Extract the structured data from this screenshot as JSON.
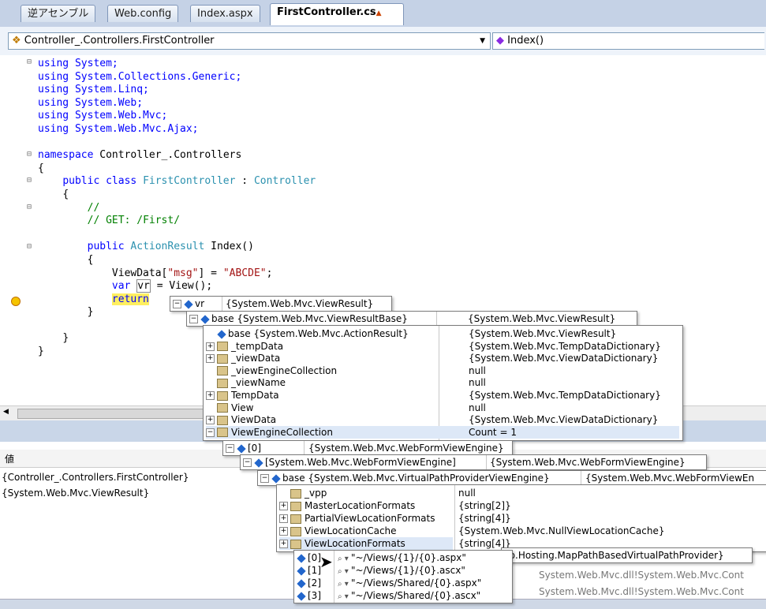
{
  "tabs": [
    {
      "label": "逆アセンブル"
    },
    {
      "label": "Web.config"
    },
    {
      "label": "Index.aspx"
    },
    {
      "label": "FirstController.cs"
    }
  ],
  "nav": {
    "class_combo": "Controller_.Controllers.FirstController",
    "member_combo": "Index()"
  },
  "code": {
    "l1": "using System;",
    "l2": "using System.Collections.Generic;",
    "l3": "using System.Linq;",
    "l4": "using System.Web;",
    "l5": "using System.Web.Mvc;",
    "l6": "using System.Web.Mvc.Ajax;",
    "ns_kw": "namespace",
    "ns_name": " Controller_.Controllers",
    "brace": "{",
    "brace_close": "}",
    "cls_kw": "public class ",
    "cls_name": "FirstController",
    "cls_sep": " : ",
    "cls_base": "Controller",
    "cmt1": "//",
    "cmt2": "// GET: /First/",
    "m_kw": "public ",
    "m_type": "ActionResult",
    "m_rest": " Index()",
    "vd_a": "ViewData[",
    "vd_key": "\"msg\"",
    "vd_b": "] = ",
    "vd_val": "\"ABCDE\"",
    "vd_c": ";",
    "var_kw": "var ",
    "var_name": "vr",
    "var_rest": " = View();",
    "ret": "return"
  },
  "tip1": {
    "name": "vr",
    "value": "{System.Web.Mvc.ViewResult}"
  },
  "tip2": {
    "name": "base {System.Web.Mvc.ViewResultBase}",
    "value": "{System.Web.Mvc.ViewResult}"
  },
  "tip3": [
    {
      "name": "base {System.Web.Mvc.ActionResult}",
      "value": "{System.Web.Mvc.ViewResult}"
    },
    {
      "name": "_tempData",
      "value": "{System.Web.Mvc.TempDataDictionary}"
    },
    {
      "name": "_viewData",
      "value": "{System.Web.Mvc.ViewDataDictionary}"
    },
    {
      "name": "_viewEngineCollection",
      "value": "null"
    },
    {
      "name": "_viewName",
      "value": "null"
    },
    {
      "name": "TempData",
      "value": "{System.Web.Mvc.TempDataDictionary}"
    },
    {
      "name": "View",
      "value": "null"
    },
    {
      "name": "ViewData",
      "value": "{System.Web.Mvc.ViewDataDictionary}"
    },
    {
      "name": "ViewEngineCollection",
      "value": "Count = 1"
    }
  ],
  "tip4": {
    "name": "[0]",
    "value": "{System.Web.Mvc.WebFormViewEngine}"
  },
  "tip5": {
    "name": "[System.Web.Mvc.WebFormViewEngine]",
    "value": "{System.Web.Mvc.WebFormViewEngine}"
  },
  "tip6": {
    "name": "base {System.Web.Mvc.VirtualPathProviderViewEngine}",
    "value": "{System.Web.Mvc.WebFormViewEn"
  },
  "tip7": [
    {
      "name": "_vpp",
      "value": "null"
    },
    {
      "name": "MasterLocationFormats",
      "value": "{string[2]}"
    },
    {
      "name": "PartialViewLocationFormats",
      "value": "{string[4]}"
    },
    {
      "name": "ViewLocationCache",
      "value": "{System.Web.Mvc.NullViewLocationCache}"
    },
    {
      "name": "ViewLocationFormats",
      "value": "{string[4]}"
    }
  ],
  "tip8": {
    "value": "eb.Hosting.MapPathBasedVirtualPathProvider}"
  },
  "tip9": [
    {
      "idx": "[0]",
      "value": "\"~/Views/{1}/{0}.aspx\""
    },
    {
      "idx": "[1]",
      "value": "\"~/Views/{1}/{0}.ascx\""
    },
    {
      "idx": "[2]",
      "value": "\"~/Views/Shared/{0}.aspx\""
    },
    {
      "idx": "[3]",
      "value": "\"~/Views/Shared/{0}.ascx\""
    }
  ],
  "panel": {
    "header": "値",
    "rows": [
      "{Controller_.Controllers.FirstController}",
      "{System.Web.Mvc.ViewResult}"
    ],
    "right_rows": [
      "System.Web.Mvc.dll!System.Web.Mvc.Cont",
      "System.Web.Mvc.dll!System.Web.Mvc.Cont"
    ]
  }
}
